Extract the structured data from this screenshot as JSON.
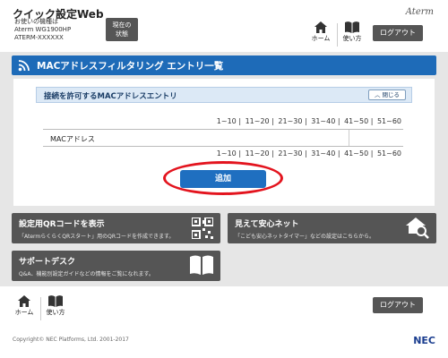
{
  "header": {
    "app_title": "クイック設定Web",
    "device_label": "お使いの機種は",
    "device_model": "Aterm WG1900HP",
    "device_id": "ATERM-XXXXXX",
    "status_button": [
      "現在の",
      "状態"
    ],
    "home_label": "ホーム",
    "help_label": "使い方",
    "brand": "Aterm",
    "logout_label": "ログアウト"
  },
  "page": {
    "title": "MACアドレスフィルタリング エントリ一覧",
    "section_title": "接続を許可するMACアドレスエントリ",
    "close_label": "閉じる",
    "pager": [
      "1~10",
      "11~20",
      "21~30",
      "31~40",
      "41~50",
      "51~60"
    ],
    "table_header": "MACアドレス",
    "add_label": "追加"
  },
  "cards": {
    "qr_title": "設定用QRコードを表示",
    "qr_desc": "「AtermらくらくQRスタート」用のQRコードを作成できます。",
    "safe_title": "見えて安心ネット",
    "safe_desc": "「こども安心ネットタイマー」などの設定はこちらから。",
    "support_title": "サポートデスク",
    "support_desc": "Q&A、機能別設定ガイドなどの情報をご覧になれます。"
  },
  "footer": {
    "home_label": "ホーム",
    "help_label": "使い方",
    "logout_label": "ログアウト",
    "copyright": "Copyright© NEC Platforms, Ltd. 2001-2017",
    "logo": "NEC"
  },
  "colors": {
    "accent_blue": "#1e6bb8",
    "highlight_red": "#e3141e",
    "dark_gray": "#555555"
  }
}
